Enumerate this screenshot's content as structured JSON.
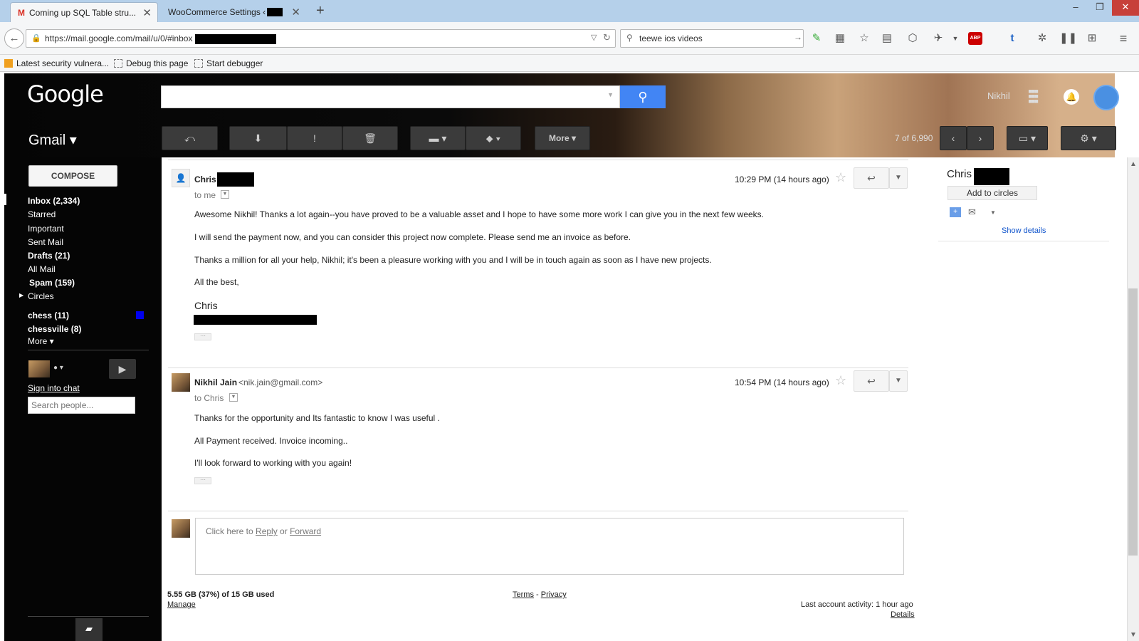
{
  "browser": {
    "tabs": [
      {
        "title": "Coming up SQL Table stru..."
      },
      {
        "title": "WooCommerce Settings ‹ "
      }
    ],
    "url": "https://mail.google.com/mail/u/0/#inbox",
    "search": "teewe ios videos",
    "bookmarks": [
      "Latest security vulnera...",
      "Debug this page",
      "Start debugger"
    ]
  },
  "header": {
    "logo": "Google",
    "app": "Gmail ▾",
    "user": "Nikhil",
    "more_label": "More ▾",
    "pager": "7 of 6,990"
  },
  "sidebar": {
    "compose": "COMPOSE",
    "items": [
      {
        "label": "Inbox (2,334)",
        "bold": true
      },
      {
        "label": "Starred"
      },
      {
        "label": "Important"
      },
      {
        "label": "Sent Mail"
      },
      {
        "label": "Drafts (21)",
        "bold": true
      },
      {
        "label": "All Mail"
      },
      {
        "label": "Spam (159)",
        "bold": true
      },
      {
        "label": "Circles"
      }
    ],
    "labels": [
      {
        "label": "chess (11)"
      },
      {
        "label": "chessville (8)"
      },
      {
        "label": "More ▾"
      }
    ],
    "chat_signin": "Sign into chat",
    "search_people_placeholder": "Search people..."
  },
  "messages": [
    {
      "sender": "Chris",
      "recipient": "to me",
      "time": "10:29 PM (14 hours ago)",
      "lines": [
        "Awesome Nikhil! Thanks a lot again--you have proved to be a valuable asset and I hope to have some more work I can give you in the next few weeks.",
        "I will send the payment now, and you can consider this project now complete. Please send me an invoice as before.",
        "Thanks a million for all your help, Nikhil; it's been a pleasure working with you and I will be in touch again as soon as I have new projects.",
        "All the best,"
      ],
      "signature": "Chris"
    },
    {
      "sender": "Nikhil Jain",
      "email": "<nik.jain@gmail.com>",
      "recipient": "to Chris",
      "time": "10:54 PM (14 hours ago)",
      "lines": [
        "Thanks for the opportunity and Its fantastic to know I was useful .",
        "All Payment received. Invoice incoming..",
        "I'll look forward to working with you again!"
      ]
    }
  ],
  "reply": {
    "prefix": "Click here to ",
    "reply": "Reply",
    "or": " or ",
    "forward": "Forward"
  },
  "footer": {
    "storage": "5.55 GB (37%) of 15 GB used",
    "manage": "Manage",
    "terms": "Terms",
    "dash": " - ",
    "privacy": "Privacy",
    "activity": "Last account activity: 1 hour ago",
    "details": "Details"
  },
  "contact": {
    "name": "Chris",
    "add_circles": "Add to circles",
    "show_details": "Show details"
  },
  "icons": {
    "gmail_m": "gmail-m-icon",
    "search": "search-icon",
    "apps": "apps-grid-icon",
    "bell": "notifications-icon",
    "back": "back-arrow-icon",
    "archive": "archive-icon",
    "spam": "report-spam-icon",
    "delete": "trash-icon",
    "folder": "move-to-folder-icon",
    "label": "label-icon",
    "gear": "gear-icon"
  },
  "colors": {
    "accent": "#4285f4",
    "chess_label": "#0000ee"
  }
}
